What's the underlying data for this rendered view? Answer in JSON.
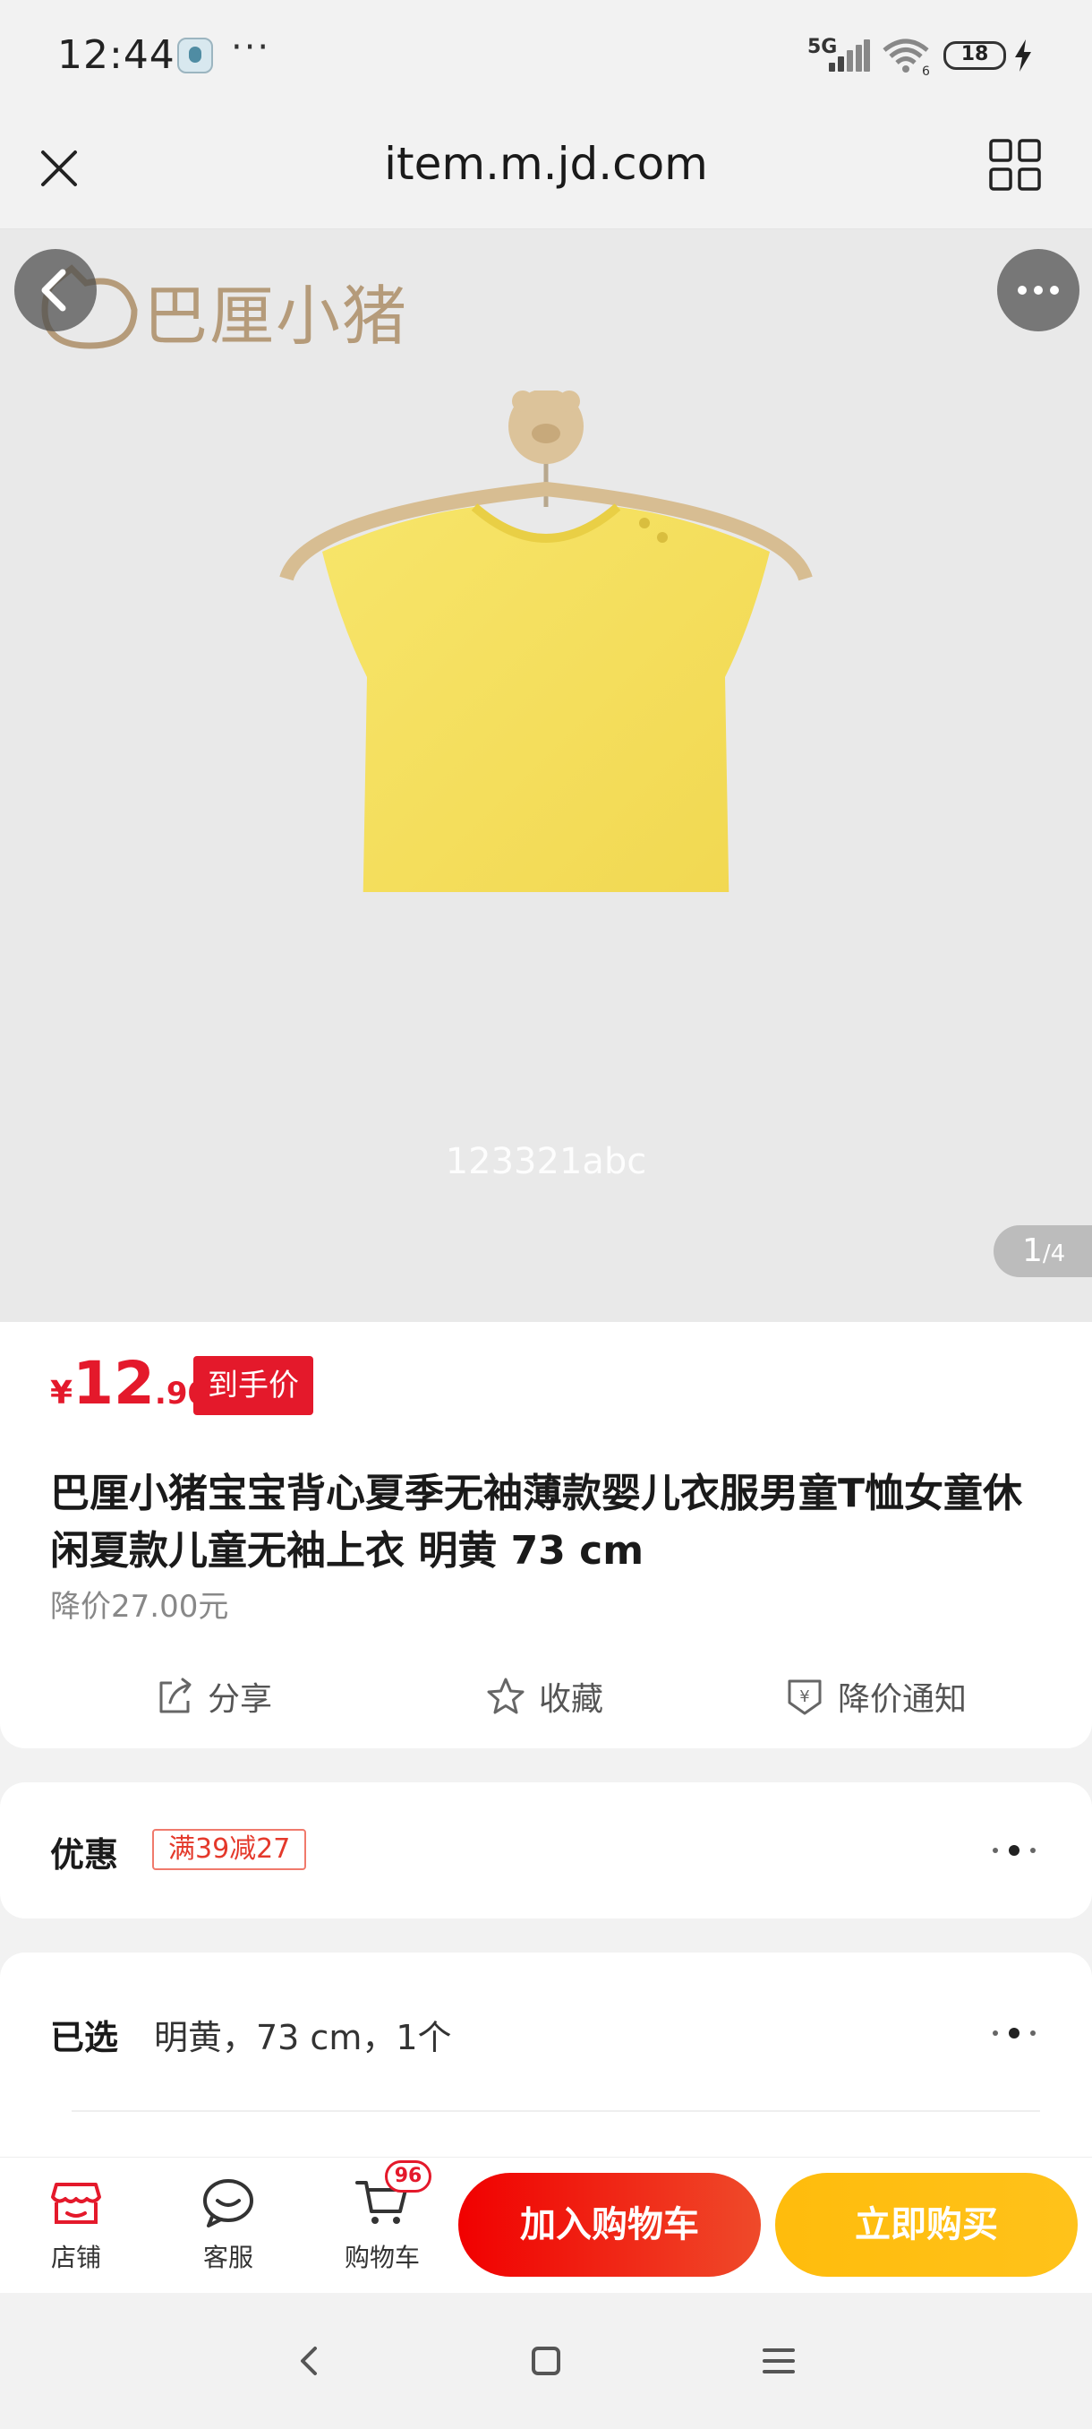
{
  "status_bar": {
    "time": "12:44",
    "network": "5G",
    "battery": "18"
  },
  "browser": {
    "url": "item.m.jd.com"
  },
  "gallery": {
    "brand": "巴厘小猪",
    "watermark": "123321abc",
    "current": "1",
    "total": "/4"
  },
  "product": {
    "price_symbol": "¥",
    "price_int": "12",
    "price_dec": ".90",
    "price_badge": "到手价",
    "title": "巴厘小猪宝宝背心夏季无袖薄款婴儿衣服男童T恤女童休闲夏款儿童无袖上衣 明黄 73 cm",
    "price_drop": "降价27.00元",
    "actions": {
      "share": "分享",
      "favorite": "收藏",
      "price_alert": "降价通知"
    }
  },
  "promo": {
    "label": "优惠",
    "coupon": "满39减27"
  },
  "selection": {
    "label": "已选",
    "value": "明黄，73 cm，1个"
  },
  "bottom_bar": {
    "store": "店铺",
    "service": "客服",
    "cart": "购物车",
    "cart_count": "96",
    "add_to_cart": "加入购物车",
    "buy_now": "立即购买"
  },
  "colors": {
    "accent_red": "#e4192b",
    "buy_yellow": "#ffbc0c",
    "shirt": "#f5e063"
  }
}
